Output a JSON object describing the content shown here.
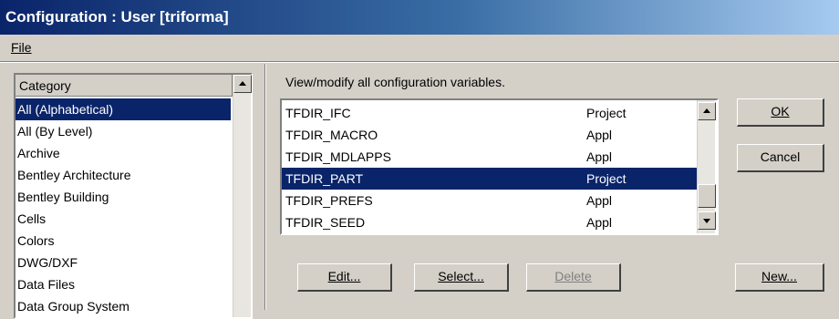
{
  "window": {
    "title": "Configuration : User [triforma]"
  },
  "menu": {
    "file_label": "File"
  },
  "category": {
    "header": "Category",
    "items": [
      "All (Alphabetical)",
      "All (By Level)",
      "Archive",
      "Bentley Architecture",
      "Bentley Building",
      "Cells",
      "Colors",
      "DWG/DXF",
      "Data Files",
      "Data Group System"
    ],
    "selected_index": 0
  },
  "variables": {
    "caption": "View/modify all configuration variables.",
    "rows": [
      {
        "name": "TFDIR_IFC",
        "level": "Project"
      },
      {
        "name": "TFDIR_MACRO",
        "level": "Appl"
      },
      {
        "name": "TFDIR_MDLAPPS",
        "level": "Appl"
      },
      {
        "name": "TFDIR_PART",
        "level": "Project"
      },
      {
        "name": "TFDIR_PREFS",
        "level": "Appl"
      },
      {
        "name": "TFDIR_SEED",
        "level": "Appl"
      }
    ],
    "selected_index": 3
  },
  "buttons": {
    "ok": "OK",
    "cancel": "Cancel",
    "edit": "Edit...",
    "select": "Select...",
    "delete": "Delete",
    "new": "New..."
  },
  "colors": {
    "selection": "#0a246a",
    "face": "#d4d0c8",
    "title_start": "#0a246a",
    "title_end": "#a6caf0"
  }
}
